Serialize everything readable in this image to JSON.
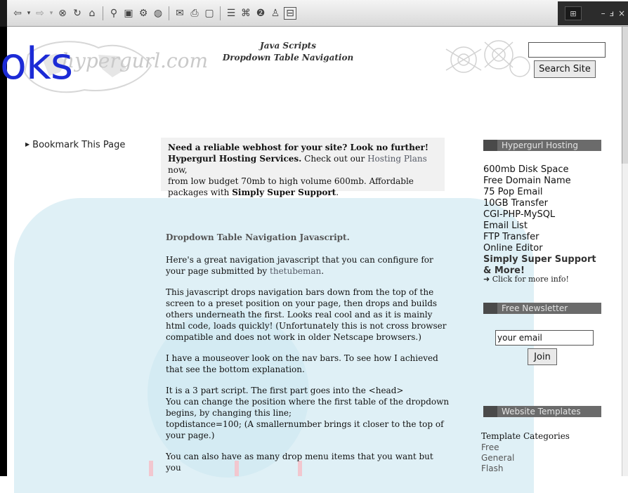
{
  "toolbar": {
    "icons": [
      "back-arrow",
      "back-dropdown",
      "forward-arrow",
      "forward-dropdown",
      "stop",
      "refresh",
      "home",
      "search",
      "favorites",
      "history",
      "media",
      "mail",
      "print",
      "edit",
      "discuss",
      "research",
      "messenger",
      "full-screen"
    ]
  },
  "header": {
    "overlay_text": "oks",
    "logo_text": "hypergurl.com",
    "title_line1": "Java Scripts",
    "title_line2": "Dropdown Table Navigation",
    "search_button": "Search Site"
  },
  "left": {
    "bookmark": "Bookmark This Page"
  },
  "promo": {
    "line1": "Need a reliable webhost for your site? Look no further!",
    "bold2": "Hypergurl Hosting Services.",
    "text2a": " Check out our ",
    "link2": "Hosting Plans",
    "text2b": " now,",
    "line3": "from low budget 70mb to high volume 600mb. Affordable",
    "line4a": "packages with ",
    "line4b": "Simply Super Support",
    "line4c": "."
  },
  "article": {
    "heading": "Dropdown Table Navigation Javascript.",
    "p1a": "Here's a great navigation javascript that you can configure for your page submitted by ",
    "p1_link": "thetubeman",
    "p1b": ".",
    "p2": "This javascript drops navigation bars down from the top of the screen to a preset position on your page, then drops and builds others underneath the first. Looks real cool and as it is mainly html code, loads quickly! (Unfortunately this is not cross browser compatible and does not work in older Netscape browsers.)",
    "p3": "I have a mouseover look on the nav bars. To see how I achieved that see the bottom explanation.",
    "p4_l1": "It is a 3 part script. The first part goes into the <head>",
    "p4_l2": "You can change the position where the first table of the dropdown begins, by changing this line;",
    "p4_l3": "topdistance=100; (A smallernumber brings it closer to the top of your page.)",
    "p5": "You can also have as many drop menu items that you want but you"
  },
  "sidebar": {
    "hosting_header": "Hypergurl Hosting",
    "hosting_items": [
      "600mb Disk Space",
      "Free Domain Name",
      "75 Pop Email",
      "10GB Transfer",
      "CGI-PHP-MySQL",
      "Email List",
      "FTP Transfer",
      "Online Editor"
    ],
    "support_line1": "Simply Super Support",
    "support_line2": "& More!",
    "click_more": "Click for more info!",
    "newsletter_header": "Free Newsletter",
    "email_value": "your email",
    "join_button": "Join",
    "templates_header": "Website Templates",
    "template_categories": "Template Categories",
    "template_items": [
      "Free",
      "General",
      "Flash"
    ]
  },
  "colors": {
    "overlay_blue": "#1c2bd6",
    "cyan_bg": "#dff0f6",
    "sidebar_header": "#6b6b6b"
  }
}
